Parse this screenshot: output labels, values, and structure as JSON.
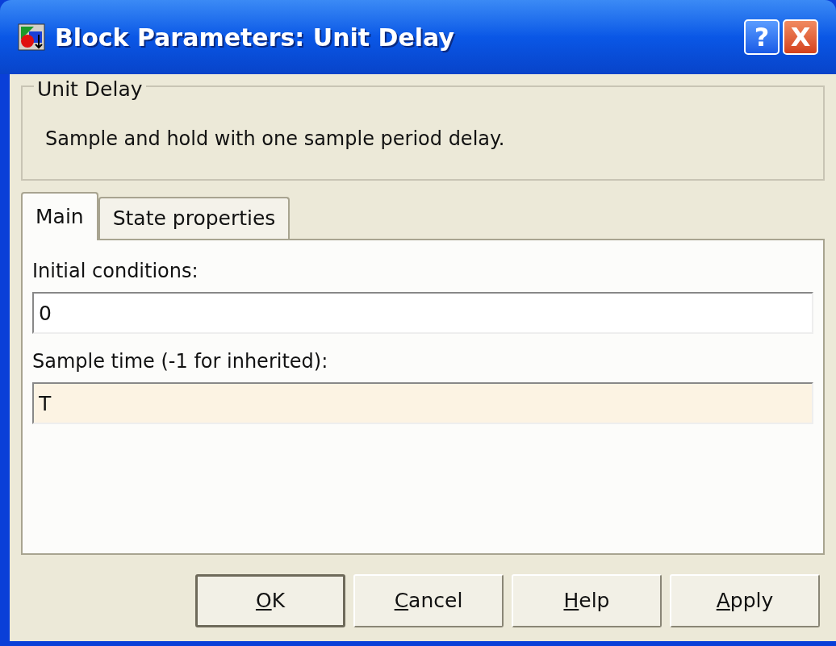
{
  "window": {
    "title": "Block Parameters: Unit Delay",
    "controls": [
      {
        "kind": "help",
        "label": "?"
      },
      {
        "kind": "close",
        "label": "X"
      }
    ]
  },
  "group": {
    "title": "Unit Delay",
    "description": "Sample and hold with one sample period delay."
  },
  "tabs": [
    {
      "label": "Main",
      "selected": true
    },
    {
      "label": "State properties",
      "selected": false
    }
  ],
  "fields": [
    {
      "label": "Initial conditions:",
      "value": "0",
      "highlighted": false
    },
    {
      "label": "Sample time (-1 for inherited):",
      "value": "T",
      "highlighted": true
    }
  ],
  "buttons": [
    {
      "label": "OK",
      "default": true
    },
    {
      "label": "Cancel",
      "default": false
    },
    {
      "label": "Help",
      "default": false
    },
    {
      "label": "Apply",
      "default": false
    }
  ]
}
